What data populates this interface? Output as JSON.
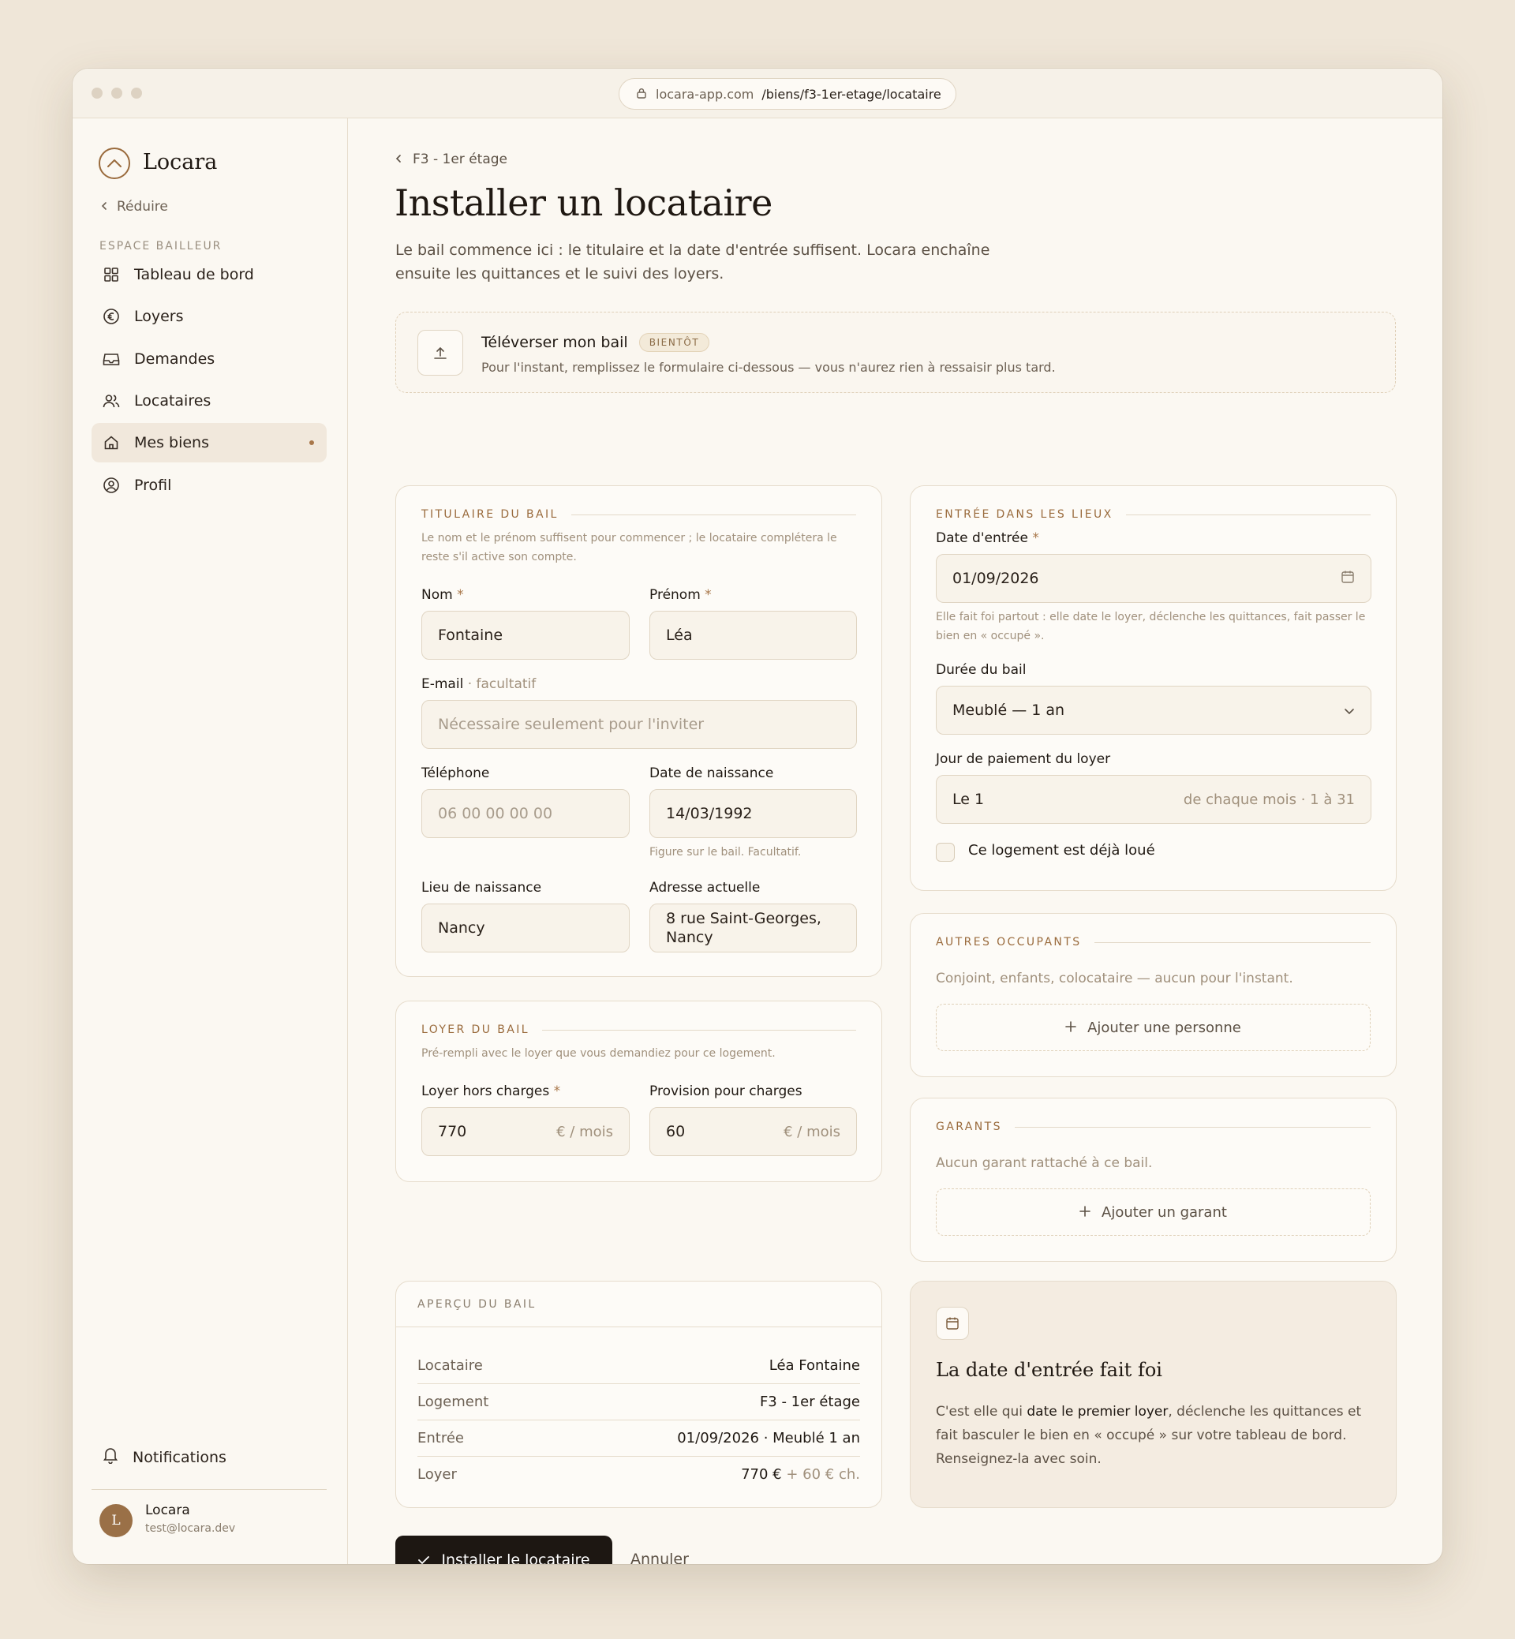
{
  "browser": {
    "url_host": "locara-app.com",
    "url_path": "/biens/f3-1er-etage/locataire"
  },
  "sidebar": {
    "brand": "Locara",
    "collapse_label": "Réduire",
    "section_label": "ESPACE BAILLEUR",
    "items": [
      {
        "label": "Tableau de bord",
        "icon": "grid-icon"
      },
      {
        "label": "Loyers",
        "icon": "euro-icon"
      },
      {
        "label": "Demandes",
        "icon": "inbox-icon"
      },
      {
        "label": "Locataires",
        "icon": "users-icon"
      },
      {
        "label": "Mes biens",
        "icon": "home-icon",
        "active": true
      },
      {
        "label": "Profil",
        "icon": "user-circle-icon"
      }
    ],
    "notifications_label": "Notifications",
    "user": {
      "initial": "L",
      "name": "Locara",
      "email": "test@locara.dev"
    }
  },
  "page": {
    "breadcrumb": "F3 - 1er étage",
    "title": "Installer un locataire",
    "description": "Le bail commence ici : le titulaire et la date d'entrée suffisent. Locara enchaîne ensuite les quittances et le suivi des loyers."
  },
  "upload": {
    "title": "Téléverser mon bail",
    "badge": "BIENTÔT",
    "subtitle": "Pour l'instant, remplissez le formulaire ci-dessous — vous n'aurez rien à ressaisir plus tard."
  },
  "holder": {
    "heading": "TITULAIRE DU BAIL",
    "subtitle": "Le nom et le prénom suffisent pour commencer ; le locataire complétera le reste s'il active son compte.",
    "required_mark": "*",
    "nom_label": "Nom",
    "nom_value": "Fontaine",
    "prenom_label": "Prénom",
    "prenom_value": "Léa",
    "email_label": "E-mail",
    "email_optional": "· facultatif",
    "email_placeholder": "Nécessaire seulement pour l'inviter",
    "phone_label": "Téléphone",
    "phone_placeholder": "06 00 00 00 00",
    "birthdate_label": "Date de naissance",
    "birthdate_value": "14/03/1992",
    "birthdate_hint": "Figure sur le bail. Facultatif.",
    "birthplace_label": "Lieu de naissance",
    "birthplace_value": "Nancy",
    "address_label": "Adresse actuelle",
    "address_value": "8 rue Saint-Georges, Nancy"
  },
  "rent": {
    "heading": "LOYER DU BAIL",
    "subtitle": "Pré-rempli avec le loyer que vous demandiez pour ce logement.",
    "rent_label": "Loyer hors charges",
    "rent_value": "770",
    "charges_label": "Provision pour charges",
    "charges_value": "60",
    "unit": "€ / mois"
  },
  "entry": {
    "heading": "ENTRÉE DANS LES LIEUX",
    "date_label": "Date d'entrée",
    "date_value": "01/09/2026",
    "date_hint": "Elle fait foi partout : elle date le loyer, déclenche les quittances, fait passer le bien en « occupé ».",
    "duration_label": "Durée du bail",
    "duration_value": "Meublé — 1 an",
    "payday_label": "Jour de paiement du loyer",
    "payday_value": "Le 1",
    "payday_suffix": "de chaque mois · 1 à 31",
    "already_rented_label": "Ce logement est déjà loué",
    "already_rented_checked": false
  },
  "occupants": {
    "heading": "AUTRES OCCUPANTS",
    "subtitle": "Conjoint, enfants, colocataire — aucun pour l'instant.",
    "add_label": "Ajouter une personne"
  },
  "guarantors": {
    "heading": "GARANTS",
    "subtitle": "Aucun garant rattaché à ce bail.",
    "add_label": "Ajouter un garant"
  },
  "summary": {
    "heading": "APERÇU DU BAIL",
    "rows": [
      {
        "key": "Locataire",
        "value": "Léa Fontaine"
      },
      {
        "key": "Logement",
        "value": "F3 - 1er étage"
      },
      {
        "key": "Entrée",
        "value": "01/09/2026 · Meublé 1 an"
      },
      {
        "key": "Loyer",
        "value": "770 €",
        "extra": "+ 60 € ch."
      }
    ]
  },
  "info": {
    "title": "La date d'entrée fait foi",
    "body_before": "C'est elle qui ",
    "body_bold": "date le premier loyer",
    "body_after": ", déclenche les quittances et fait basculer le bien en « occupé » sur votre tableau de bord. Renseignez-la avec soin."
  },
  "actions": {
    "submit_label": "Installer le locataire",
    "cancel_label": "Annuler"
  },
  "colors": {
    "background": "#efe6d8",
    "accent": "#9a6b3d",
    "primary_button": "#1d1712"
  }
}
